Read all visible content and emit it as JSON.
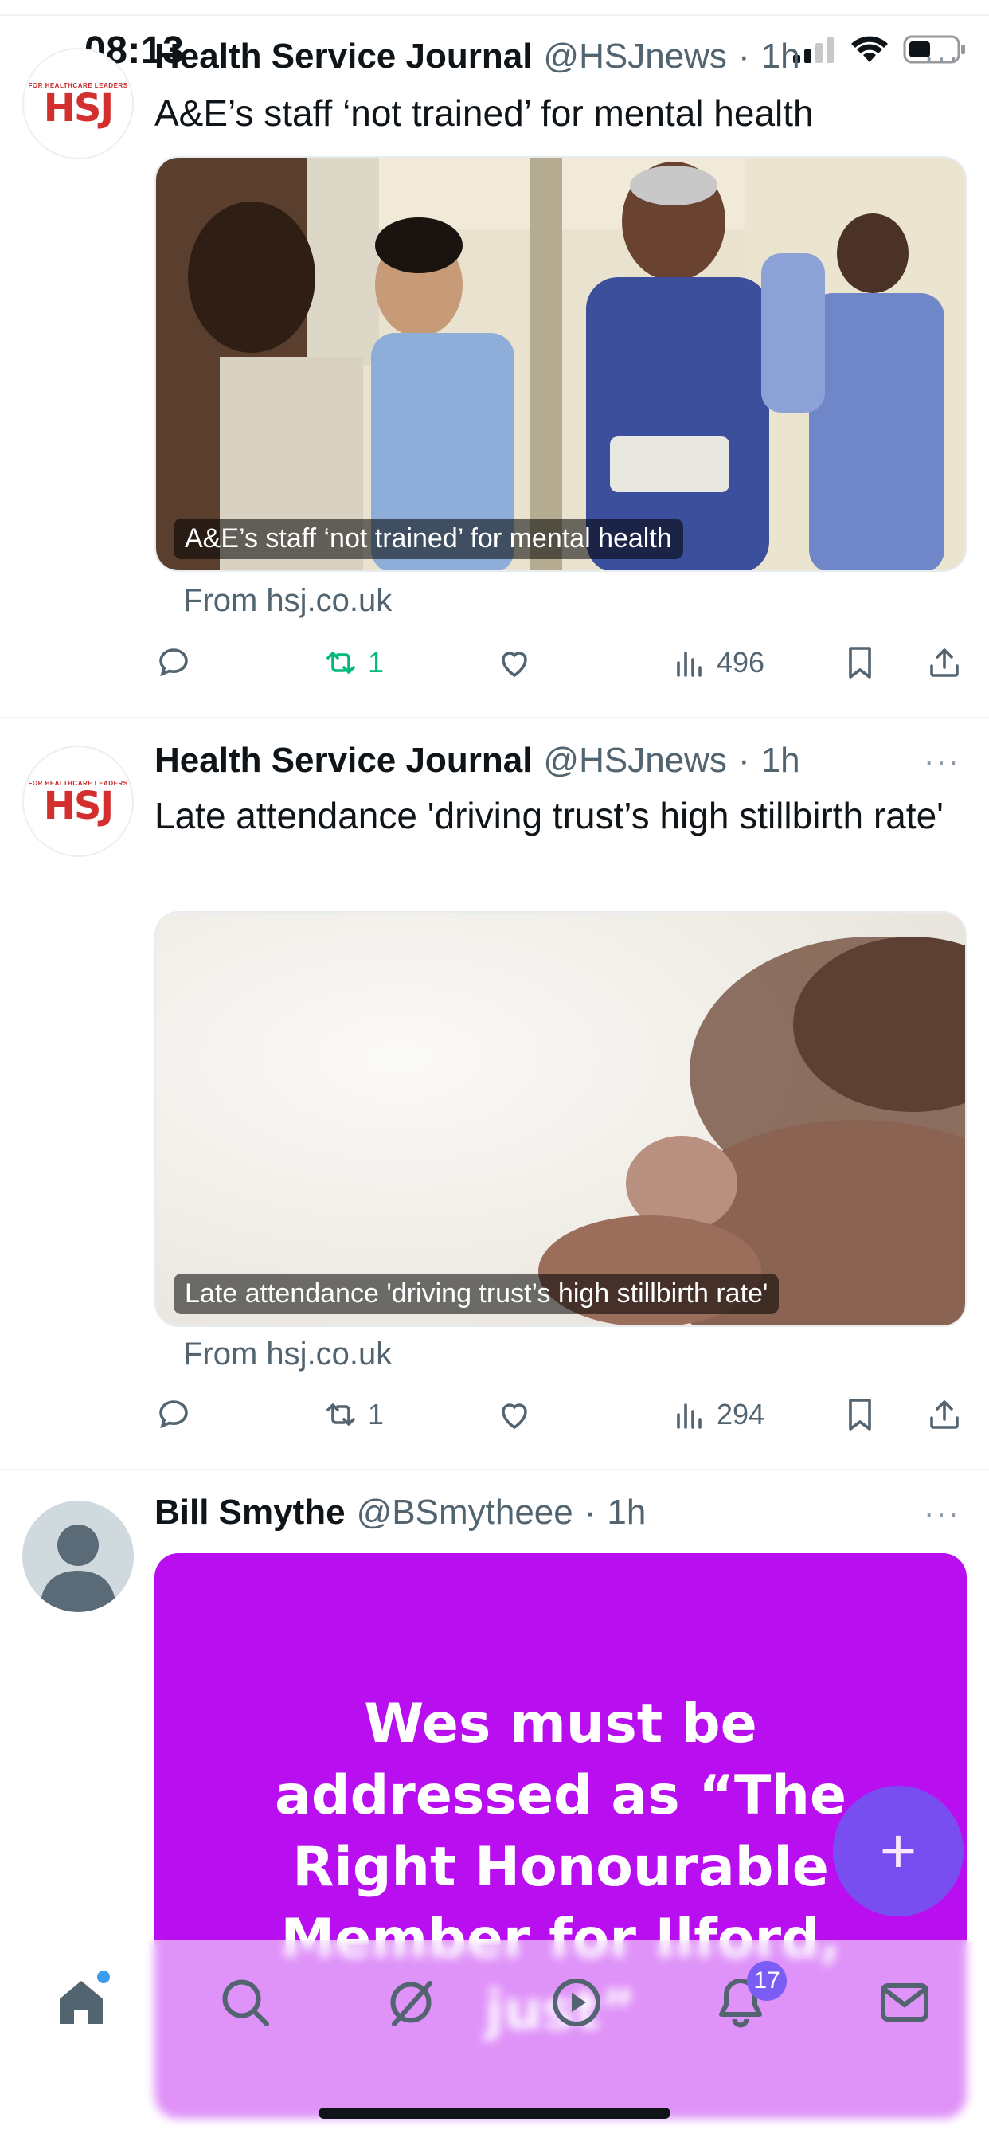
{
  "status_bar": {
    "time": "08:13"
  },
  "tweets": [
    {
      "name": "Health Service Journal",
      "handle": "@HSJnews",
      "separator": "·",
      "time": "1h",
      "text": "A&E’s staff ‘not trained’ for mental health",
      "card_caption": "A&E’s staff ‘not trained’ for mental health",
      "card_source": "From hsj.co.uk",
      "retweets": "1",
      "views": "496",
      "retweeted": true
    },
    {
      "name": "Health Service Journal",
      "handle": "@HSJnews",
      "separator": "·",
      "time": "1h",
      "text": "Late attendance 'driving trust’s high stillbirth rate'",
      "card_caption": "Late attendance 'driving trust’s high stillbirth rate'",
      "card_source": "From hsj.co.uk",
      "retweets": "1",
      "views": "294",
      "retweeted": false
    },
    {
      "name": "Bill Smythe",
      "handle": "@BSmytheee",
      "separator": "·",
      "time": "1h",
      "image_text": "Wes must be addressed as “The Right Honourable Member for Ilford, just”"
    }
  ],
  "hsj_avatar": {
    "tagline": "FOR HEALTHCARE LEADERS",
    "logo": "HSJ"
  },
  "nav": {
    "items": [
      "home-icon",
      "search-icon",
      "grok-icon",
      "video-icon",
      "notifications-icon",
      "messages-icon"
    ],
    "notifications_badge": "17"
  },
  "fab": {
    "label": "+"
  },
  "colors": {
    "accent": "#7256f2",
    "retweet_active": "#00ba7c",
    "purple_card": "#b80ef0"
  }
}
